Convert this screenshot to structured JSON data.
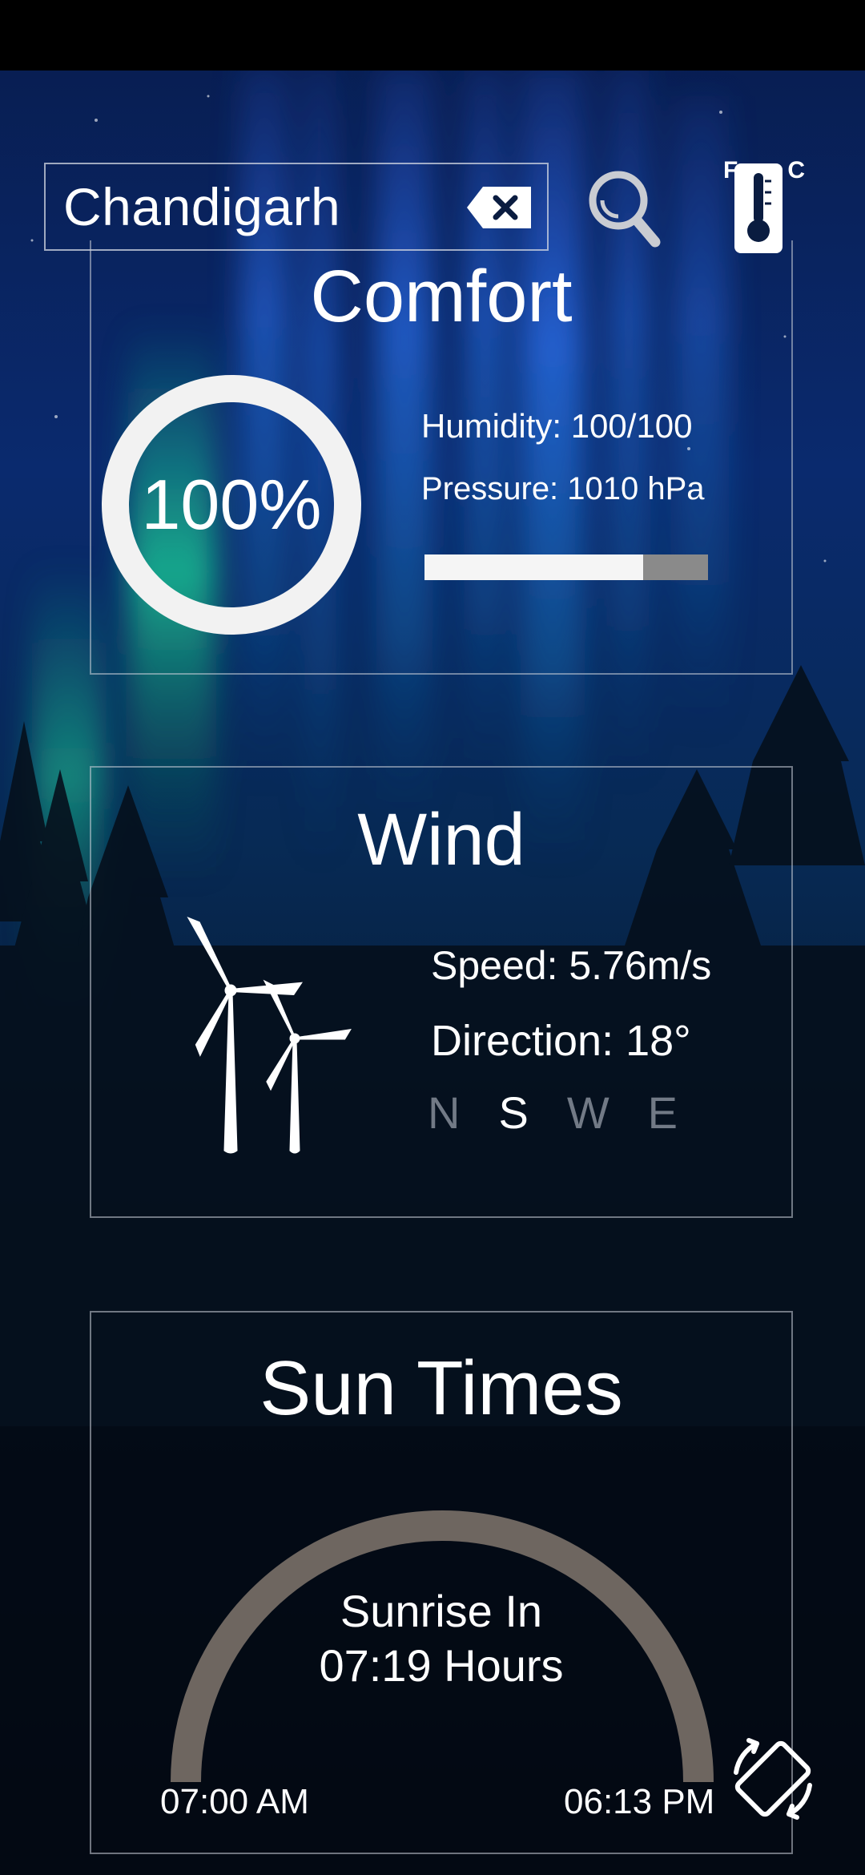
{
  "search": {
    "value": "Chandigarh",
    "clear_icon": "backspace-clear-icon",
    "search_icon": "magnifier-icon"
  },
  "units": {
    "fahrenheit": "F",
    "celsius": "C",
    "icon": "thermometer-icon"
  },
  "comfort": {
    "title": "Comfort",
    "percent_text": "100%",
    "percent_value": 100,
    "humidity": "Humidity: 100/100",
    "pressure": "Pressure: 1010 hPa",
    "bar_fraction": 0.77
  },
  "wind": {
    "title": "Wind",
    "speed": "Speed: 5.76m/s",
    "direction": "Direction: 18°",
    "compass": [
      "N",
      "S",
      "W",
      "E"
    ],
    "active_direction": "S",
    "icon": "wind-turbine-icon"
  },
  "sun": {
    "title": "Sun Times",
    "line1": "Sunrise In",
    "line2": "07:19 Hours",
    "sunrise": "07:00 AM",
    "sunset": "06:13 PM"
  },
  "colors": {
    "ring": "#f2f2f2",
    "bar_track": "#8a8a8a",
    "arc": "#6e6660",
    "compass_inactive": "#727a86"
  },
  "rotate_icon": "screen-rotate-icon"
}
